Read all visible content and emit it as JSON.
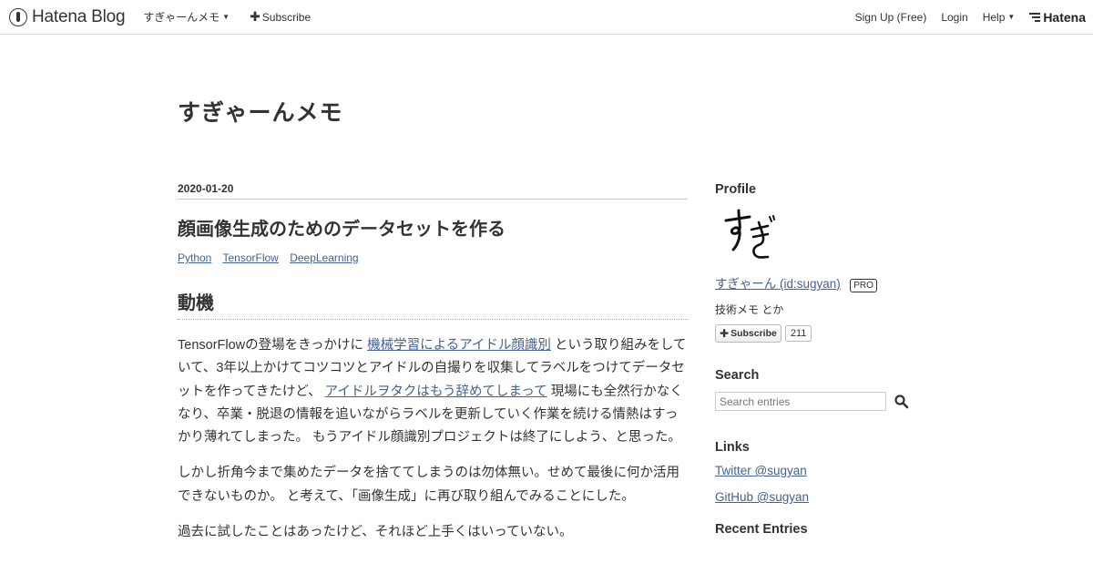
{
  "header": {
    "brand": "Hatena Blog",
    "blog_menu": "すぎゃーんメモ",
    "subscribe": "Subscribe",
    "signup": "Sign Up (Free)",
    "login": "Login",
    "help": "Help",
    "hatena": "Hatena"
  },
  "blog": {
    "title": "すぎゃーんメモ"
  },
  "article": {
    "date": "2020-01-20",
    "title": "顔画像生成のためのデータセットを作る",
    "categories": [
      "Python",
      "TensorFlow",
      "DeepLearning"
    ],
    "section_heading": "動機",
    "p1": {
      "t1": "TensorFlowの登場をきっかけに ",
      "link1": "機械学習によるアイドル顔識別",
      "t2": " という取り組みをしていて、3年以上かけてコツコツとアイドルの自撮りを収集してラベルをつけてデータセットを作ってきたけど、 ",
      "link2": "アイドルヲタクはもう辞めてしまって",
      "t3": " 現場にも全然行かなくなり、卒業・脱退の情報を追いながらラベルを更新していく作業を続ける情熱はすっかり薄れてしまった。 もうアイドル顔識別プロジェクトは終了にしよう、と思った。"
    },
    "p2": "しかし折角今まで集めたデータを捨ててしまうのは勿体無い。せめて最後に何か活用できないものか。 と考えて、「画像生成」に再び取り組んでみることにした。",
    "p3": "過去に試したことはあったけど、それほど上手くはいっていない。"
  },
  "sidebar": {
    "profile": {
      "heading": "Profile",
      "name_link": "すぎゃーん (id:sugyan)",
      "badge": "PRO",
      "description": "技術メモ とか",
      "subscribe_label": "Subscribe",
      "subscriber_count": "211"
    },
    "search": {
      "heading": "Search",
      "placeholder": "Search entries"
    },
    "links": {
      "heading": "Links",
      "items": [
        "Twitter @sugyan",
        "GitHub @sugyan"
      ]
    },
    "recent": {
      "heading": "Recent Entries"
    }
  }
}
